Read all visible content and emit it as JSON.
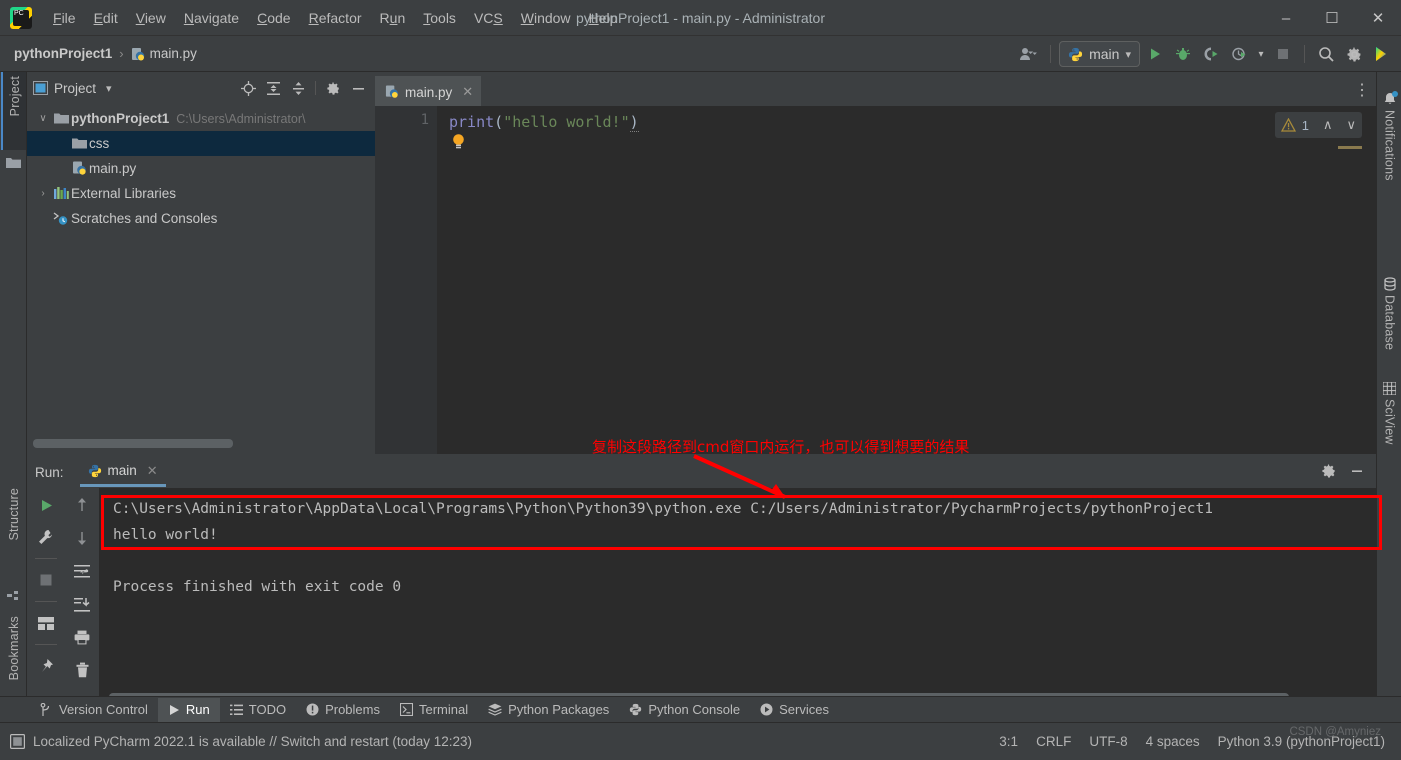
{
  "window": {
    "title": "pythonProject1 - main.py - Administrator",
    "minimize_label": "–",
    "maximize_label": "☐",
    "close_label": "✕"
  },
  "menu": [
    {
      "label": "File"
    },
    {
      "label": "Edit"
    },
    {
      "label": "View"
    },
    {
      "label": "Navigate"
    },
    {
      "label": "Code"
    },
    {
      "label": "Refactor"
    },
    {
      "label": "Run"
    },
    {
      "label": "Tools"
    },
    {
      "label": "VCS"
    },
    {
      "label": "Window"
    },
    {
      "label": "Help"
    }
  ],
  "breadcrumb": {
    "project": "pythonProject1",
    "separator": "›",
    "file": "main.py"
  },
  "toolbar": {
    "run_config": "main",
    "dropdown_caret": "▾",
    "icons": [
      "user-icon",
      "run-icon",
      "debug-icon",
      "coverage-icon",
      "profile-icon",
      "stop-icon",
      "search-icon",
      "settings-icon",
      "ai-assistant-icon"
    ]
  },
  "left_strip": {
    "project_label": "Project",
    "structure_label": "Structure",
    "bookmarks_label": "Bookmarks"
  },
  "right_strip": {
    "notifications_label": "Notifications",
    "database_label": "Database",
    "sciview_label": "SciView"
  },
  "project_panel": {
    "title": "Project",
    "caret": "▾",
    "tools": [
      "locate-icon",
      "expand-all-icon",
      "collapse-all-icon",
      "settings-icon",
      "hide-icon"
    ],
    "tree": [
      {
        "label": "pythonProject1",
        "sub": "C:\\Users\\Administrator\\",
        "icon": "folder-icon",
        "arrow": "∨",
        "depth": 0,
        "bold": true,
        "selected": false
      },
      {
        "label": "css",
        "sub": "",
        "icon": "folder-icon",
        "arrow": "",
        "depth": 1,
        "bold": false,
        "selected": true
      },
      {
        "label": "main.py",
        "sub": "",
        "icon": "python-file-icon",
        "arrow": "",
        "depth": 1,
        "bold": false,
        "selected": false
      },
      {
        "label": "External Libraries",
        "sub": "",
        "icon": "libraries-icon",
        "arrow": "›",
        "depth": 0,
        "bold": false,
        "selected": false
      },
      {
        "label": "Scratches and Consoles",
        "sub": "",
        "icon": "scratches-icon",
        "arrow": "",
        "depth": 0,
        "bold": false,
        "selected": false
      }
    ]
  },
  "editor": {
    "tab_label": "main.py",
    "tab_close": "✕",
    "line_number": "1",
    "code": {
      "fn": "print",
      "lparen": "(",
      "string": "\"hello world!\"",
      "rparen": ")"
    },
    "warning_count": "1",
    "warning_icon": "warning-triangle-icon",
    "chevron_up": "∧",
    "chevron_down": "∨",
    "bulb_icon": "intention-bulb-icon",
    "more_icon": "⋮"
  },
  "run_panel": {
    "label": "Run:",
    "tab_label": "main",
    "tab_close": "✕",
    "tools_left": [
      "rerun-icon",
      "wrench-icon",
      "stop-icon",
      "layout-icon",
      "pin-icon"
    ],
    "tools_right": [
      "up-arrow-icon",
      "down-arrow-icon",
      "soft-wrap-icon",
      "scroll-to-end-icon",
      "print-icon",
      "trash-icon"
    ],
    "header_tools": [
      "settings-icon",
      "hide-icon"
    ],
    "console_lines": [
      "C:\\Users\\Administrator\\AppData\\Local\\Programs\\Python\\Python39\\python.exe C:/Users/Administrator/PycharmProjects/pythonProject1",
      "hello world!",
      "",
      "Process finished with exit code 0"
    ]
  },
  "annotation": {
    "text": "复制这段路径到cmd窗口内运行，也可以得到想要的结果",
    "color": "#ff0000"
  },
  "bottom_bar": [
    {
      "label": "Version Control",
      "icon": "branch-icon",
      "active": false
    },
    {
      "label": "Run",
      "icon": "run-icon",
      "active": true
    },
    {
      "label": "TODO",
      "icon": "todo-icon",
      "active": false
    },
    {
      "label": "Problems",
      "icon": "problems-icon",
      "active": false
    },
    {
      "label": "Terminal",
      "icon": "terminal-icon",
      "active": false
    },
    {
      "label": "Python Packages",
      "icon": "packages-icon",
      "active": false
    },
    {
      "label": "Python Console",
      "icon": "python-icon",
      "active": false
    },
    {
      "label": "Services",
      "icon": "services-icon",
      "active": false
    }
  ],
  "status_bar": {
    "message": "Localized PyCharm 2022.1 is available // Switch and restart (today 12:23)",
    "message_icon": "ide-update-icon",
    "caret_position": "3:1",
    "line_separator": "CRLF",
    "encoding": "UTF-8",
    "indent": "4 spaces",
    "interpreter": "Python 3.9 (pythonProject1)"
  },
  "watermark": "CSDN @Amyniez",
  "colors": {
    "bg": "#3c3f41",
    "editor_bg": "#2b2b2b",
    "selection": "#0d293e",
    "accent_green": "#499c54",
    "annotation_red": "#ff0000",
    "string_green": "#6a8759",
    "keyword_purple": "#8888c6"
  }
}
